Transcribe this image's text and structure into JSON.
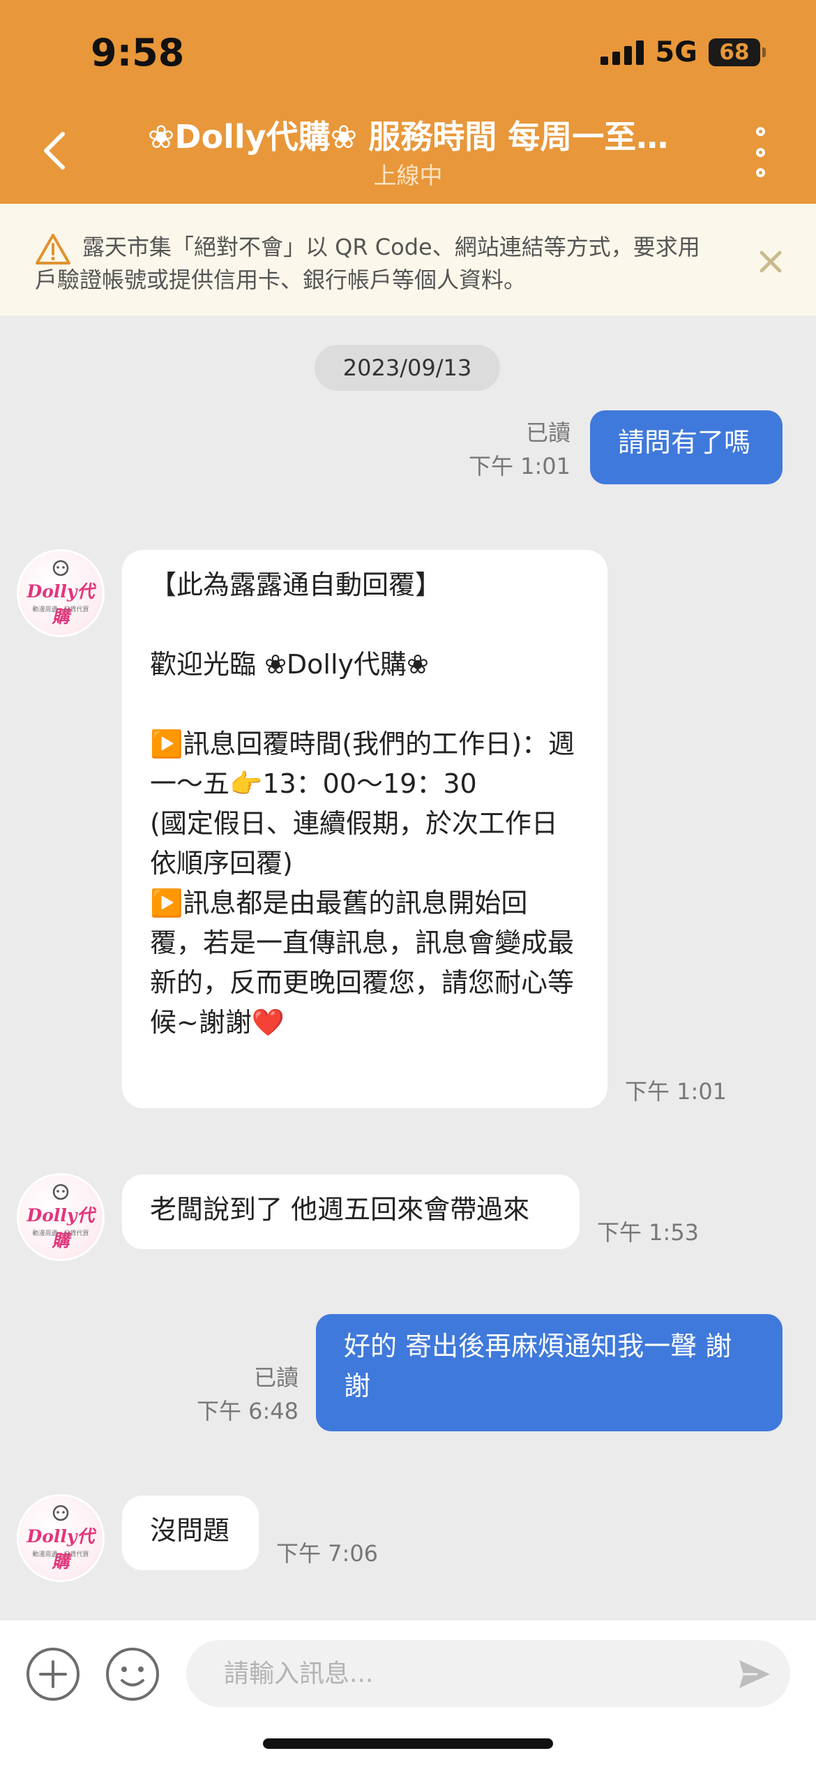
{
  "status_bar": {
    "time": "9:58",
    "network": "5G",
    "battery": "68"
  },
  "header": {
    "title": "❀Dolly代購❀ 服務時間 每周一至…",
    "status": "上線中"
  },
  "warning": {
    "text": "露天市集「絕對不會」以 QR Code、網站連結等方式，要求用戶驗證帳號或提供信用卡、銀行帳戶等個人資料。"
  },
  "chat": {
    "date": "2023/09/13",
    "avatar_label": "Dolly代購",
    "avatar_sub": "動漫周邊．日貨代買",
    "messages": [
      {
        "from": "me",
        "text": "請問有了嗎",
        "read": "已讀",
        "time": "下午 1:01"
      },
      {
        "from": "them",
        "text": "【此為露露通自動回覆】\n\n歡迎光臨 ❀Dolly代購❀\n\n▶️訊息回覆時間(我們的工作日)：週一～五👉13：00～19：30\n(國定假日、連續假期，於次工作日依順序回覆)\n▶️訊息都是由最舊的訊息開始回覆，若是一直傳訊息，訊息會變成最新的，反而更晚回覆您，請您耐心等候~謝謝❤️",
        "time": "下午 1:01"
      },
      {
        "from": "them",
        "text": "老闆說到了 他週五回來會帶過來",
        "time": "下午 1:53"
      },
      {
        "from": "me",
        "text": "好的 寄出後再麻煩通知我一聲 謝謝",
        "read": "已讀",
        "time": "下午 6:48"
      },
      {
        "from": "them",
        "text": "沒問題",
        "time": "下午 7:06"
      }
    ]
  },
  "input": {
    "placeholder": "請輸入訊息..."
  },
  "colors": {
    "header": "#e8973a",
    "my_bubble": "#3f79db",
    "background": "#ebebeb"
  }
}
